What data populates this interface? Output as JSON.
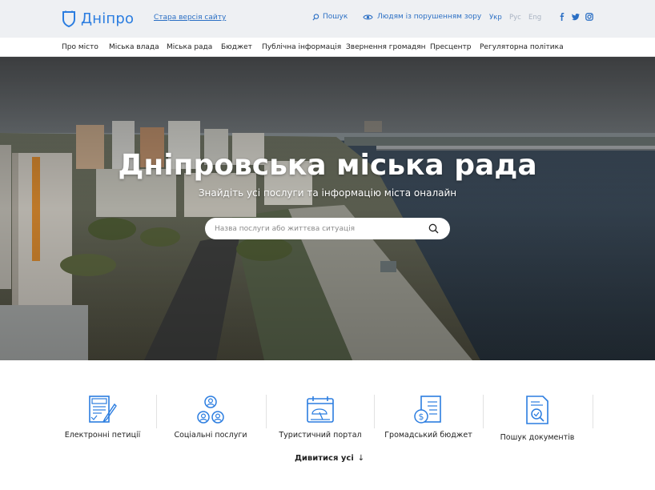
{
  "header": {
    "logo_text": "Дніпро",
    "old_site": "Стара версія сайту",
    "search": "Пошук",
    "vision": "Людям із порушенням зору",
    "languages": [
      "Укр",
      "Рус",
      "Eng"
    ],
    "social": [
      "facebook-icon",
      "twitter-icon",
      "instagram-icon"
    ]
  },
  "nav": {
    "items": [
      "Про місто",
      "Міська влада",
      "Міська рада",
      "Бюджет",
      "Публічна інформація",
      "Звернення громадян",
      "Пресцентр",
      "Регуляторна політика"
    ]
  },
  "hero": {
    "title": "Дніпровська міська рада",
    "subtitle": "Знайдіть усі послуги та інформацію міста оналайн",
    "search_placeholder": "Назва послуги або життєва ситуація"
  },
  "services": {
    "items": [
      {
        "label": "Електронні петиції",
        "icon": "petition-icon"
      },
      {
        "label": "Соціальні послуги",
        "icon": "people-icon"
      },
      {
        "label": "Туристичний портал",
        "icon": "tourist-icon"
      },
      {
        "label": "Громадський бюджет",
        "icon": "budget-icon"
      },
      {
        "label": "Пошук документів",
        "icon": "document-search-icon"
      }
    ],
    "see_all": "Дивитися усі",
    "see_all_arrow": "↓"
  },
  "colors": {
    "brand": "#2b7de0",
    "link": "#2b6fc4",
    "topbar": "#eef0f3"
  }
}
